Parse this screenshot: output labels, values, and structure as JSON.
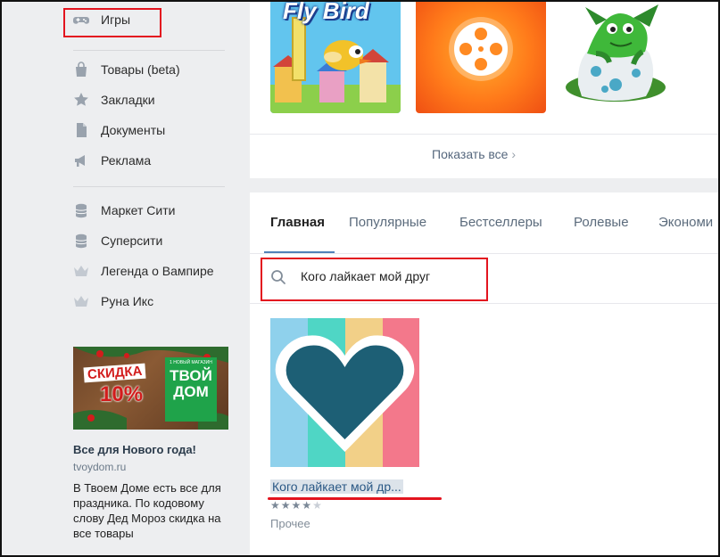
{
  "sidebar": {
    "items": [
      {
        "label": "Игры",
        "icon": "gamepad-icon"
      },
      {
        "label": "Товары (beta)",
        "icon": "shopping-bag-icon"
      },
      {
        "label": "Закладки",
        "icon": "star-icon"
      },
      {
        "label": "Документы",
        "icon": "document-icon"
      },
      {
        "label": "Реклама",
        "icon": "megaphone-icon"
      },
      {
        "label": "Маркет Сити",
        "icon": "coin-stack-icon"
      },
      {
        "label": "Суперсити",
        "icon": "coin-stack-icon"
      },
      {
        "label": "Легенда о Вампире",
        "icon": "crown-icon"
      },
      {
        "label": "Руна Икс",
        "icon": "crown-icon"
      }
    ],
    "ad": {
      "banner_sale": "СКИДКА",
      "banner_percent": "10%",
      "banner_brand_small": "1 НОВЫЙ МАГАЗИН",
      "banner_brand_line1": "ТВОЙ",
      "banner_brand_line2": "ДОМ",
      "title": "Все для Нового года!",
      "domain": "tvoydom.ru",
      "text": "В Твоем Доме есть все для праздника. По кодовому слову Дед Мороз скидка на все товары"
    }
  },
  "top_games": {
    "fly_bird_title": "Fly Bird",
    "show_all": "Показать все"
  },
  "tabs": [
    {
      "label": "Главная",
      "active": true
    },
    {
      "label": "Популярные"
    },
    {
      "label": "Бестселлеры"
    },
    {
      "label": "Ролевые"
    },
    {
      "label": "Экономи"
    }
  ],
  "search": {
    "value": "Кого лайкает мой друг"
  },
  "result": {
    "title": "Кого лайкает мой др...",
    "rating": 4,
    "rating_max": 5,
    "genre": "Прочее"
  },
  "colors": {
    "accent": "#5181b8",
    "highlight": "#e3141f",
    "heart": "#1d5f75"
  }
}
